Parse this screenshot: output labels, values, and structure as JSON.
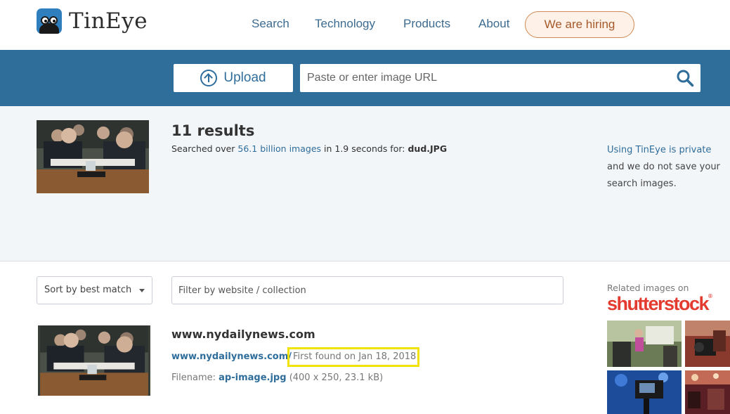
{
  "brand": {
    "name": "TinEye"
  },
  "nav": {
    "search": "Search",
    "technology": "Technology",
    "products": "Products",
    "about": "About",
    "hiring": "We are hiring"
  },
  "searchbar": {
    "upload_label": "Upload",
    "url_placeholder": "Paste or enter image URL"
  },
  "summary": {
    "count": "11 results",
    "searched_prefix": "Searched over",
    "index_size": "56.1 billion images",
    "time_text": "in 1.9 seconds for:",
    "query_file": "dud.JPG"
  },
  "privacy": {
    "link": "Using TinEye is private",
    "text": "and we do not save your search images."
  },
  "filters": {
    "sort_label": "Sort by best match",
    "filter_placeholder": "Filter by website / collection"
  },
  "results": [
    {
      "site": "www.nydailynews.com",
      "url": "www.nydailynews.com/",
      "first_found": "First found on Jan 18, 2018",
      "filename_label": "Filename:",
      "filename": "ap-image.jpg",
      "file_info": "(400 x 250, 23.1 kB)"
    }
  ],
  "sidebar": {
    "related_label": "Related images on",
    "provider": "shutterstock",
    "provider_mark": "®"
  },
  "colors": {
    "accent": "#2f6d9b",
    "hiring": "#a65a2b",
    "highlight": "#f2e200",
    "shutterstock": "#e33b2f"
  }
}
